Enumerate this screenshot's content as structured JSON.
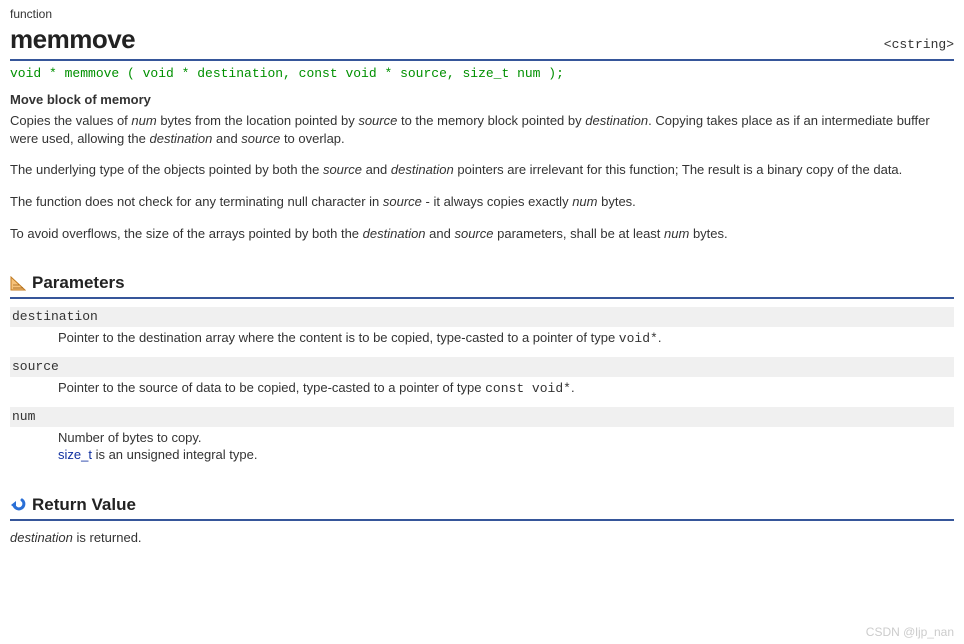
{
  "kind_label": "function",
  "title": "memmove",
  "header_tag": "<cstring>",
  "signature": "void * memmove ( void * destination, const void * source, size_t num );",
  "subheading": "Move block of memory",
  "description": {
    "p1a": "Copies the values of ",
    "p1_num": "num",
    "p1b": " bytes from the location pointed by ",
    "p1_source": "source",
    "p1c": " to the memory block pointed by ",
    "p1_dest": "destination",
    "p1d": ". Copying takes place as if an intermediate buffer were used, allowing the ",
    "p1_dest2": "destination",
    "p1e": " and ",
    "p1_source2": "source",
    "p1f": " to overlap.",
    "p2a": "The underlying type of the objects pointed by both the ",
    "p2_source": "source",
    "p2b": " and ",
    "p2_dest": "destination",
    "p2c": " pointers are irrelevant for this function; The result is a binary copy of the data.",
    "p3a": "The function does not check for any terminating null character in ",
    "p3_source": "source",
    "p3b": " - it always copies exactly ",
    "p3_num": "num",
    "p3c": " bytes.",
    "p4a": "To avoid overflows, the size of the arrays pointed by both the ",
    "p4_dest": "destination",
    "p4b": " and ",
    "p4_source": "source",
    "p4c": " parameters, shall be at least ",
    "p4_num": "num",
    "p4d": " bytes."
  },
  "sections": {
    "parameters_title": "Parameters",
    "return_title": "Return Value"
  },
  "params": {
    "dest_name": "destination",
    "dest_desc_a": "Pointer to the destination array where the content is to be copied, type-casted to a pointer of type ",
    "dest_desc_code": "void*",
    "dest_desc_b": ".",
    "source_name": "source",
    "source_desc_a": "Pointer to the source of data to be copied, type-casted to a pointer of type ",
    "source_desc_code": "const void*",
    "source_desc_b": ".",
    "num_name": "num",
    "num_desc_line1": "Number of bytes to copy.",
    "num_desc_type": "size_t",
    "num_desc_line2": " is an unsigned integral type."
  },
  "return_value": {
    "a": "destination",
    "b": " is returned."
  },
  "watermark": "CSDN @ljp_nan"
}
